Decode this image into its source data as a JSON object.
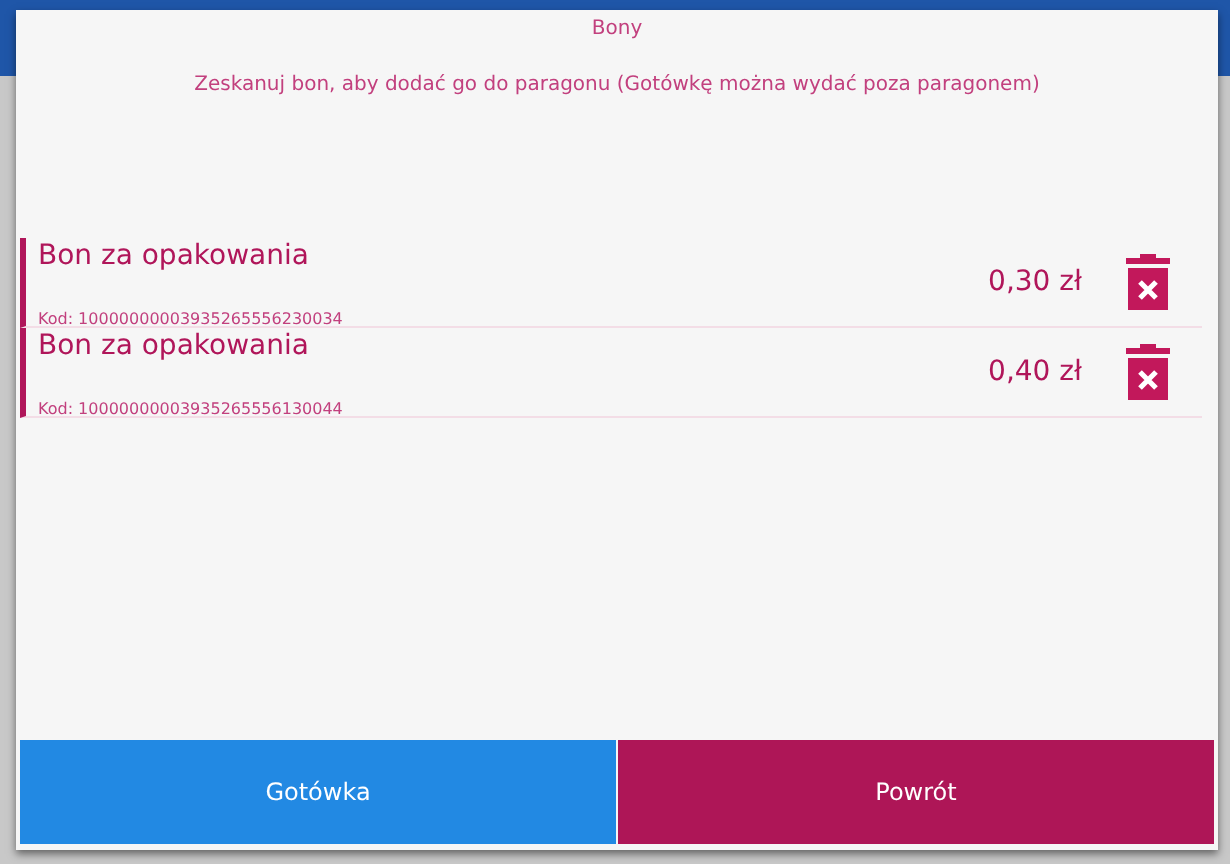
{
  "dialog": {
    "title": "Bony",
    "message": "Zeskanuj bon, aby dodać go do paragonu (Gotówkę można wydać poza paragonem)",
    "vouchers": [
      {
        "name": "Bon za opakowania",
        "code": "Kod: 10000000003935265556230034",
        "amount": "0,30 zł"
      },
      {
        "name": "Bon za opakowania",
        "code": "Kod: 10000000003935265556130044",
        "amount": "0,40 zł"
      }
    ],
    "buttons": [
      {
        "label": "Gotówka",
        "kind": "cash"
      },
      {
        "label": "Powrót",
        "kind": "back"
      }
    ]
  }
}
